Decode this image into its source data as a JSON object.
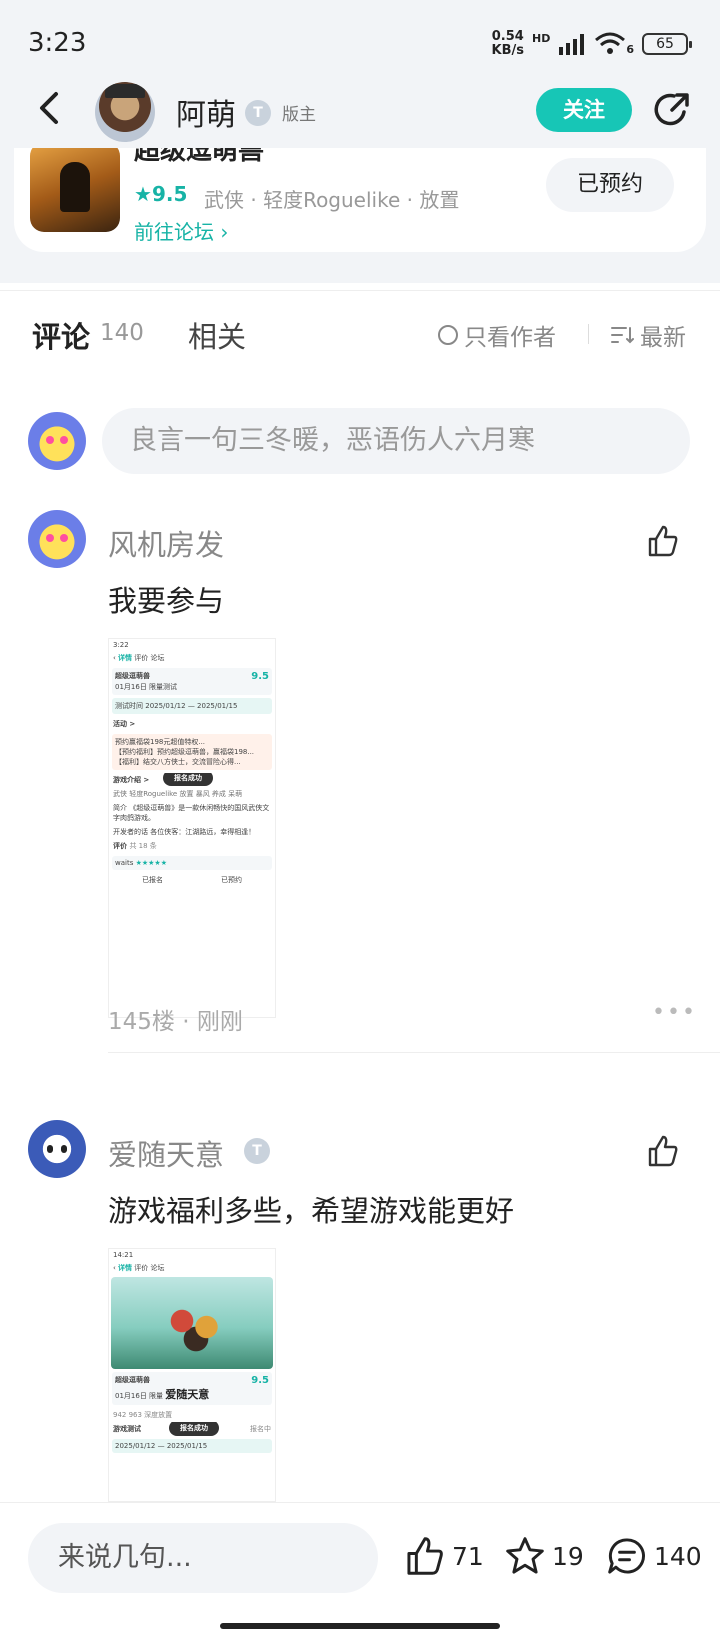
{
  "status_bar": {
    "time": "3:23",
    "net_speed_value": "0.54",
    "net_speed_unit": "KB/s",
    "network_type": "HD",
    "wifi_label": "6",
    "battery": "65"
  },
  "header": {
    "author_name": "阿萌",
    "level_badge": "T",
    "role": "版主",
    "follow_label": "关注"
  },
  "game": {
    "title": "超级逗萌兽",
    "rating": "9.5",
    "tags": "武侠 · 轻度Roguelike · 放置",
    "forum_link": "前往论坛",
    "reserve_label": "已预约"
  },
  "tabs": {
    "comments_label": "评论",
    "comments_count": "140",
    "related_label": "相关",
    "only_author_label": "只看作者",
    "sort_label": "最新"
  },
  "comment_input": {
    "placeholder": "良言一句三冬暖，恶语伤人六月寒"
  },
  "posts": [
    {
      "user": "风机房发",
      "text": "我要参与",
      "floor": "145楼",
      "time": "刚刚",
      "screenshot": {
        "time": "3:22",
        "nav_title": "详情",
        "nav_tab2": "评价",
        "nav_tab3": "论坛",
        "game_name": "超级逗萌兽",
        "game_sub": "01月16日 限量测试",
        "score": "9.5",
        "test_label": "测试时间",
        "date_from": "2025/01/12",
        "date_to": "2025/01/15",
        "activity": "活动 >",
        "act1": "预约赢福袋198元超值特权...",
        "act2": "【预约福利】预约超级逗萌兽，赢福袋198...",
        "act3": "【福利】结交八方侠士，交流冒险心得...",
        "intro": "游戏介绍 >",
        "toast": "报名成功",
        "tag_row": "武侠  轻度Roguelike  放置  暴风  养成  呆萌",
        "intro_text": "简介 《超级逗萌兽》是一款休闲畅快的国风武侠文字肉鸽游戏。",
        "dev_text": "开发者的话 各位侠客：江湖路远，幸得相逢！",
        "review_label": "评价",
        "review_count": "共 18 条",
        "reviewer": "waits",
        "btn1": "已报名",
        "btn2": "已预约"
      }
    },
    {
      "user": "爱随天意",
      "level_badge": "T",
      "text": "游戏福利多些，希望游戏能更好",
      "screenshot": {
        "time": "14:21",
        "nav_title": "详情",
        "nav_tab2": "评价",
        "nav_tab3": "论坛",
        "game_name": "超级逗萌兽",
        "game_sub": "01月16日 限量",
        "overlay_name": "爱随天意",
        "score": "9.5",
        "stats": "942     963     深度放置",
        "section": "游戏测试",
        "toast": "报名成功",
        "status": "报名中",
        "date_from": "2025/01/12",
        "date_to": "2025/01/15"
      }
    }
  ],
  "bottom_bar": {
    "input_placeholder": "来说几句...",
    "likes": "71",
    "favorites": "19",
    "comments": "140"
  },
  "colors": {
    "accent": "#17c6b6",
    "accent_text": "#17b3a6",
    "header_bg": "#f2f4f7"
  },
  "icons": [
    "back-icon",
    "share-icon",
    "star-icon",
    "chevron-right-icon",
    "circle-icon",
    "sort-icon",
    "thumbs-up-icon",
    "more-icon",
    "star-outline-icon",
    "comment-icon"
  ]
}
